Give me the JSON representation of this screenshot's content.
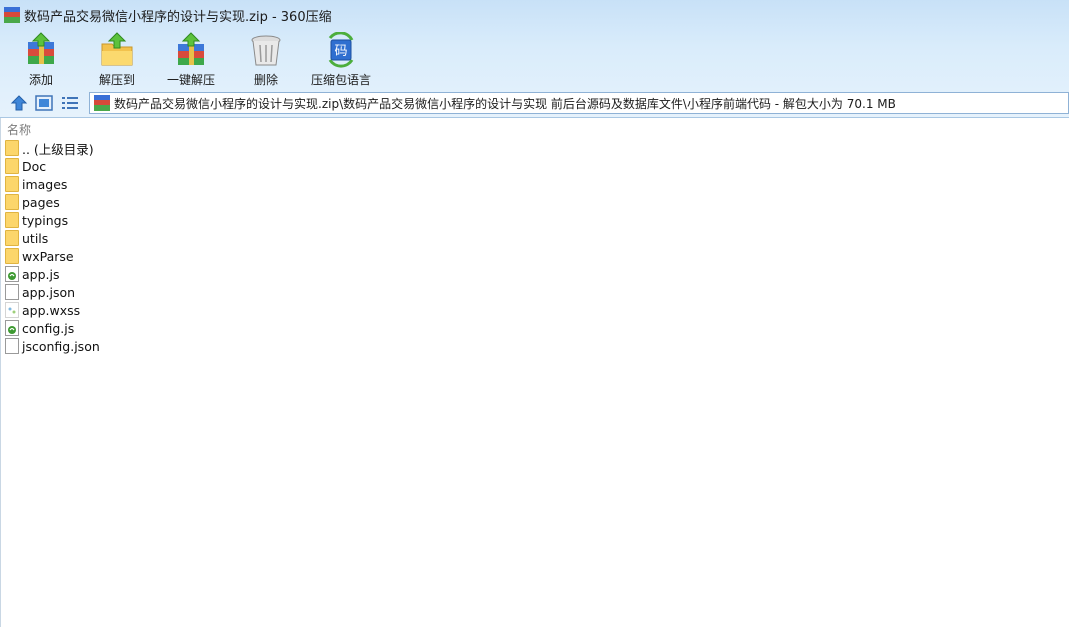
{
  "window": {
    "title": "数码产品交易微信小程序的设计与实现.zip - 360压缩"
  },
  "toolbar": {
    "add": "添加",
    "extract_to": "解压到",
    "one_click_extract": "一键解压",
    "delete": "删除",
    "language": "压缩包语言"
  },
  "address": {
    "path": "数码产品交易微信小程序的设计与实现.zip\\数码产品交易微信小程序的设计与实现 前后台源码及数据库文件\\小程序前端代码 - 解包大小为 70.1 MB"
  },
  "list": {
    "column_name": "名称",
    "items": [
      {
        "name": ".. (上级目录)",
        "type": "folder"
      },
      {
        "name": "Doc",
        "type": "folder"
      },
      {
        "name": "images",
        "type": "folder"
      },
      {
        "name": "pages",
        "type": "folder"
      },
      {
        "name": "typings",
        "type": "folder"
      },
      {
        "name": "utils",
        "type": "folder"
      },
      {
        "name": "wxParse",
        "type": "folder"
      },
      {
        "name": "app.js",
        "type": "js"
      },
      {
        "name": "app.json",
        "type": "file"
      },
      {
        "name": "app.wxss",
        "type": "wxss"
      },
      {
        "name": "config.js",
        "type": "js"
      },
      {
        "name": "jsconfig.json",
        "type": "file"
      }
    ]
  }
}
